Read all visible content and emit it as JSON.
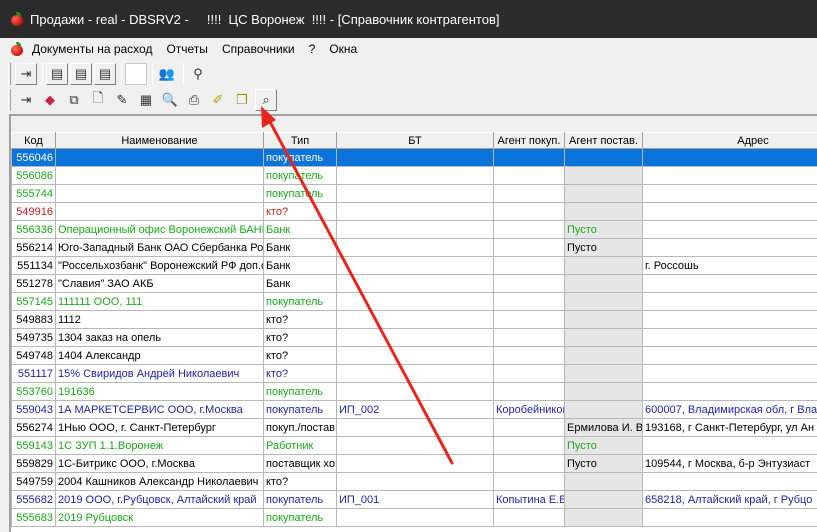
{
  "window": {
    "title": "Продажи - real - DBSRV2 -     !!!!  ЦС Воронеж  !!!! - [Справочник контрагентов]"
  },
  "menu": [
    "Документы на расход",
    "Отчеты",
    "Справочники",
    "?",
    "Окна"
  ],
  "toolbar1": [
    {
      "icon": "exit-door-icon",
      "glyph": "⇥"
    },
    {
      "icon": "list-grid-icon",
      "glyph": "▤"
    },
    {
      "icon": "list-detail-icon",
      "glyph": "▤"
    },
    {
      "icon": "list-report-icon",
      "glyph": "▤"
    },
    {
      "icon": "blank-icon",
      "glyph": ""
    },
    {
      "icon": "people-icon",
      "glyph": "👥"
    },
    {
      "icon": "user-search-icon",
      "glyph": "⚲"
    }
  ],
  "toolbar2": [
    {
      "icon": "exit-door-icon",
      "glyph": "⇥"
    },
    {
      "icon": "back-arrow-icon",
      "glyph": "◆"
    },
    {
      "icon": "copy-icon",
      "glyph": "⧉"
    },
    {
      "icon": "new-document-icon",
      "glyph": "🗋"
    },
    {
      "icon": "edit-document-icon",
      "glyph": "✎"
    },
    {
      "icon": "delete-document-icon",
      "glyph": "▦"
    },
    {
      "icon": "preview-icon",
      "glyph": "🔍"
    },
    {
      "icon": "print-icon",
      "glyph": "⎙"
    },
    {
      "icon": "pin-icon",
      "glyph": "✐"
    },
    {
      "icon": "multi-copy-icon",
      "glyph": "❐"
    },
    {
      "icon": "search-icon",
      "glyph": "⌕"
    }
  ],
  "colors": {
    "titlebar": "#2b2b2b",
    "selection": "#0a74da",
    "blue": "#1f1fa8",
    "green": "#1aa81a",
    "red": "#c81e1e",
    "black": "#000000",
    "arrow": "#e8251c"
  },
  "grid": {
    "columns": [
      "Код",
      "Наименование",
      "Тип",
      "БТ",
      "Агент покуп.",
      "Агент постав.",
      "Адрес"
    ],
    "rows": [
      {
        "color": "black",
        "selected": true,
        "cells": [
          "556046",
          "",
          "покупатель",
          "",
          "",
          "",
          ""
        ]
      },
      {
        "color": "green",
        "cells": [
          "556086",
          "",
          "покупатель",
          "",
          "",
          "",
          ""
        ]
      },
      {
        "color": "green",
        "cells": [
          "555744",
          "",
          "покупатель",
          "",
          "",
          "",
          ""
        ]
      },
      {
        "color": "red",
        "cells": [
          "549916",
          "",
          "кто?",
          "",
          "",
          "",
          ""
        ]
      },
      {
        "color": "green",
        "cells": [
          "556336",
          "Операционный офис Воронежский БАНК",
          "Банк",
          "",
          "",
          "Пусто",
          ""
        ]
      },
      {
        "color": "black",
        "cells": [
          "556214",
          "Юго-Западный Банк ОАО Сбербанка Рос",
          "Банк",
          "",
          "",
          "Пусто",
          ""
        ]
      },
      {
        "color": "black",
        "cells": [
          "551134",
          "\"Россельхозбанк\" Воронежский РФ доп.о",
          "Банк",
          "",
          "",
          "",
          "г. Россошь"
        ]
      },
      {
        "color": "black",
        "cells": [
          "551278",
          "\"Славия\" ЗАО АКБ",
          "Банк",
          "",
          "",
          "",
          ""
        ]
      },
      {
        "color": "green",
        "cells": [
          "557145",
          "111111 ООО, 111",
          "покупатель",
          "",
          "",
          "",
          ""
        ]
      },
      {
        "color": "black",
        "cells": [
          "549883",
          "1112",
          "кто?",
          "",
          "",
          "",
          ""
        ]
      },
      {
        "color": "black",
        "cells": [
          "549735",
          "1304 заказ на опель",
          "кто?",
          "",
          "",
          "",
          ""
        ]
      },
      {
        "color": "black",
        "cells": [
          "549748",
          "1404  Александр",
          "кто?",
          "",
          "",
          "",
          ""
        ]
      },
      {
        "color": "blue",
        "cells": [
          "551117",
          "15% Свиридов Андрей  Николаевич",
          "кто?",
          "",
          "",
          "",
          ""
        ]
      },
      {
        "color": "green",
        "cells": [
          "553760",
          "191636",
          "покупатель",
          "",
          "",
          "",
          ""
        ]
      },
      {
        "color": "blue",
        "cells": [
          "559043",
          "1А МАРКЕТСЕРВИС ООО, г.Москва",
          "покупатель",
          "ИП_002",
          "Коробейников",
          "",
          "600007, Владимирская обл, г Вла"
        ]
      },
      {
        "color": "black",
        "cells": [
          "556274",
          "1Нью ООО, г. Санкт-Петербург",
          "покуп./постав",
          "",
          "",
          "Ермилова И. В",
          "193168, г Санкт-Петербург, ул Ан"
        ]
      },
      {
        "color": "green",
        "cells": [
          "559143",
          "1С ЗУП 1.1.Воронеж",
          "Работник",
          "",
          "",
          "Пусто",
          ""
        ]
      },
      {
        "color": "black",
        "cells": [
          "559829",
          "1С-Битрикс ООО, г.Москва",
          "поставщик хо",
          "",
          "",
          "Пусто",
          "109544, г Москва, б-р Энтузиаст"
        ]
      },
      {
        "color": "black",
        "cells": [
          "549759",
          "2004 Кашников Александр Николаевич",
          "кто?",
          "",
          "",
          "",
          ""
        ]
      },
      {
        "color": "blue",
        "cells": [
          "555682",
          "2019 ООО, г.Рубцовск, Алтайский край",
          "покупатель",
          "ИП_001",
          "Копытина  Е.В",
          "",
          "658218, Алтайский край, г Рубцо"
        ]
      },
      {
        "color": "green",
        "cells": [
          "555683",
          "2019 Рубцовск",
          "покупатель",
          "",
          "",
          "",
          ""
        ]
      }
    ]
  }
}
